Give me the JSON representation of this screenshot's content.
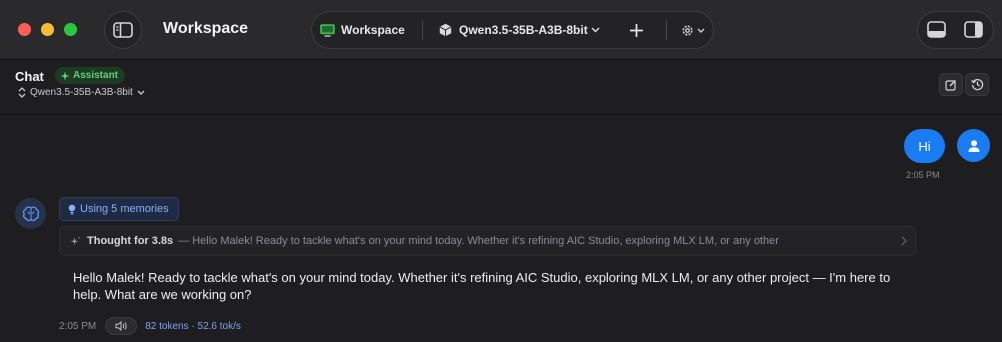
{
  "titlebar": {
    "app_title": "Workspace",
    "workspace_label": "Workspace",
    "model_label": "Qwen3.5-35B-A3B-8bit"
  },
  "chat_header": {
    "title": "Chat",
    "badge": "Assistant",
    "model": "Qwen3.5-35B-A3B-8bit"
  },
  "messages": {
    "user": {
      "text": "Hi",
      "time": "2:05 PM"
    },
    "assistant": {
      "memories": "Using 5 memories",
      "thought_label": "Thought for 3.8s",
      "thought_preview": "— Hello Malek! Ready to tackle what's on your mind today. Whether it's refining AIC Studio, exploring MLX LM, or any other",
      "answer": "Hello Malek! Ready to tackle what's on your mind today. Whether it's refining AIC Studio, exploring MLX LM, or any other project — I'm here to help. What are we working on?",
      "time": "2:05 PM",
      "stats": "82 tokens · 52.6 tok/s"
    }
  },
  "colors": {
    "accent": "#1a7cf5",
    "assistant_badge": "#5fd27a",
    "memories": "#8ab0f6",
    "close": "#ff5f57",
    "minimize": "#febc2e",
    "zoom": "#28c840"
  },
  "icons": [
    "sidebar-icon",
    "monitor-icon",
    "cube-icon",
    "chevron-down-icon",
    "plus-icon",
    "gear-icon",
    "panel-bottom-icon",
    "panel-right-icon",
    "sparkle-icon",
    "updown-icon",
    "edit-icon",
    "history-icon",
    "person-icon",
    "brain-icon",
    "bulb-icon",
    "chevron-right-icon",
    "speaker-icon"
  ]
}
